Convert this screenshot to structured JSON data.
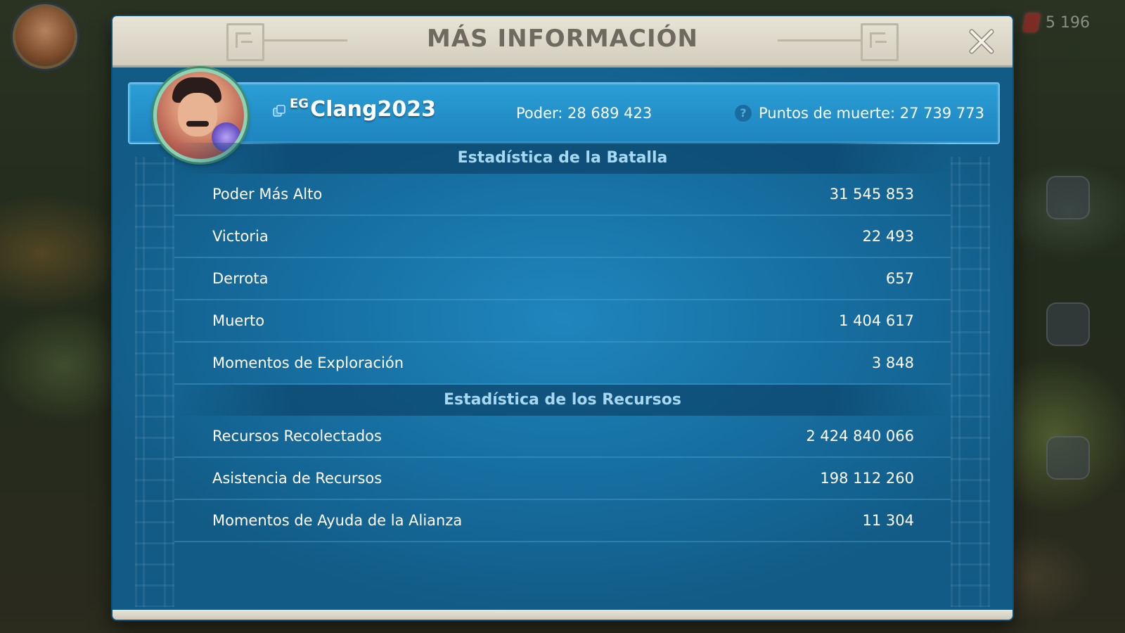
{
  "hud": {
    "gems": "5 196"
  },
  "modal": {
    "title": "MÁS INFORMACIÓN"
  },
  "player": {
    "alliance_tag": "EG",
    "name": "Clang2023",
    "power_text": "Poder: 28 689 423",
    "deaths_text": "Puntos de muerte: 27 739 773",
    "help_glyph": "?"
  },
  "battle": {
    "header": "Estadística de la Batalla",
    "rows": [
      {
        "label": "Poder Más Alto",
        "value": "31 545 853"
      },
      {
        "label": "Victoria",
        "value": "22 493"
      },
      {
        "label": "Derrota",
        "value": "657"
      },
      {
        "label": "Muerto",
        "value": "1 404 617"
      },
      {
        "label": "Momentos de Exploración",
        "value": "3 848"
      }
    ]
  },
  "resources": {
    "header": "Estadística de los Recursos",
    "rows": [
      {
        "label": "Recursos Recolectados",
        "value": "2 424 840 066"
      },
      {
        "label": "Asistencia de Recursos",
        "value": "198 112 260"
      },
      {
        "label": "Momentos de Ayuda de la Alianza",
        "value": "11 304"
      }
    ]
  },
  "colors": {
    "panel_blue": "#1a78ad",
    "title_cream": "#e8e4d6",
    "header_text": "#a6d8f2"
  },
  "icons": {
    "close": "close-icon",
    "help": "question-icon",
    "vip": "vip-badge-icon",
    "gem": "gem-icon"
  }
}
